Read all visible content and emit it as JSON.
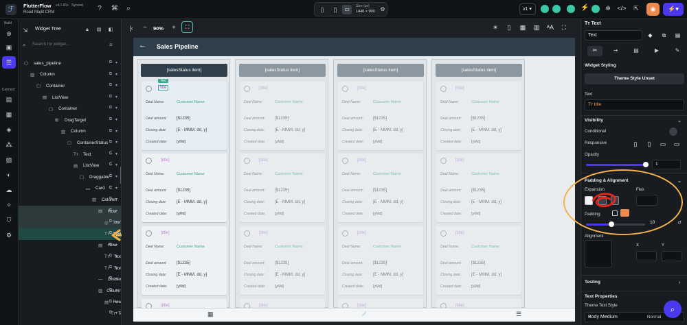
{
  "topbar": {
    "app_name": "FlutterFlow",
    "version": "v4.1.81+",
    "sync": "Synced",
    "project": "Road Majlit CRM",
    "size_label": "Size (px)",
    "size_value": "1440 × 900",
    "branch": "v1"
  },
  "rail": {
    "build": "Build",
    "connect": "Connect"
  },
  "tree": {
    "title": "Widget Tree",
    "search_placeholder": "Search for widget...",
    "rows": [
      {
        "label": "sales_pipeline",
        "indent": 0
      },
      {
        "label": "Column",
        "indent": 1
      },
      {
        "label": "Container",
        "indent": 2
      },
      {
        "label": "ListView",
        "indent": 3
      },
      {
        "label": "Container",
        "indent": 4
      },
      {
        "label": "DragTarget",
        "indent": 5
      },
      {
        "label": "Column",
        "indent": 6
      },
      {
        "label": "ContainerStatus",
        "indent": 7
      },
      {
        "label": "Text",
        "indent": 8
      },
      {
        "label": "ListView",
        "indent": 8
      },
      {
        "label": "Draggable",
        "indent": 9
      },
      {
        "label": "Card",
        "indent": 10
      },
      {
        "label": "Column",
        "indent": 11
      },
      {
        "label": "Row",
        "indent": 12
      },
      {
        "label": "Icon",
        "indent": 13
      },
      {
        "label": "Text",
        "indent": 13
      },
      {
        "label": "Row",
        "indent": 12
      },
      {
        "label": "Text",
        "indent": 13
      },
      {
        "label": "Text",
        "indent": 13
      },
      {
        "label": "Divider",
        "indent": 12
      },
      {
        "label": "Column",
        "indent": 12
      },
      {
        "label": "Row",
        "indent": 13
      },
      {
        "label": "Text",
        "indent": 14
      }
    ]
  },
  "toolbar": {
    "zoom": "90%"
  },
  "page": {
    "title": "Sales Pipeline",
    "header_label": "[salesStatus item]",
    "card": {
      "title": "[title]",
      "deal_name_label": "Deal Name:",
      "deal_name_value": "Customer Name",
      "deal_amount_label": "Deal amount:",
      "deal_amount_value": "[$1235]",
      "closing_label": "Closing date:",
      "closing_value": "[E - MMM. dd, y]",
      "created_label": "Created date:",
      "created_value": "[yMd]"
    },
    "selection_badge": "Text",
    "selection_value": "title"
  },
  "props": {
    "widget_name": "Text",
    "widget_value": "Text",
    "section_styling": "Widget Styling",
    "theme_style": "Theme Style Unset",
    "text_label": "Text",
    "text_value": "title",
    "visibility": "Visibility",
    "conditional": "Conditional",
    "responsive": "Responsive",
    "opacity": "Opacity",
    "opacity_value": "1",
    "padding_alignment": "Padding & Alignment",
    "expansion": "Expansion",
    "flex": "Flex",
    "padding": "Padding",
    "padding_value": "10",
    "alignment": "Alignment",
    "x": "X",
    "y": "Y",
    "testing": "Testing",
    "text_properties": "Text Properties",
    "theme_text_style": "Theme Text Style",
    "body_medium": "Body Medium",
    "normal": "Normal"
  }
}
